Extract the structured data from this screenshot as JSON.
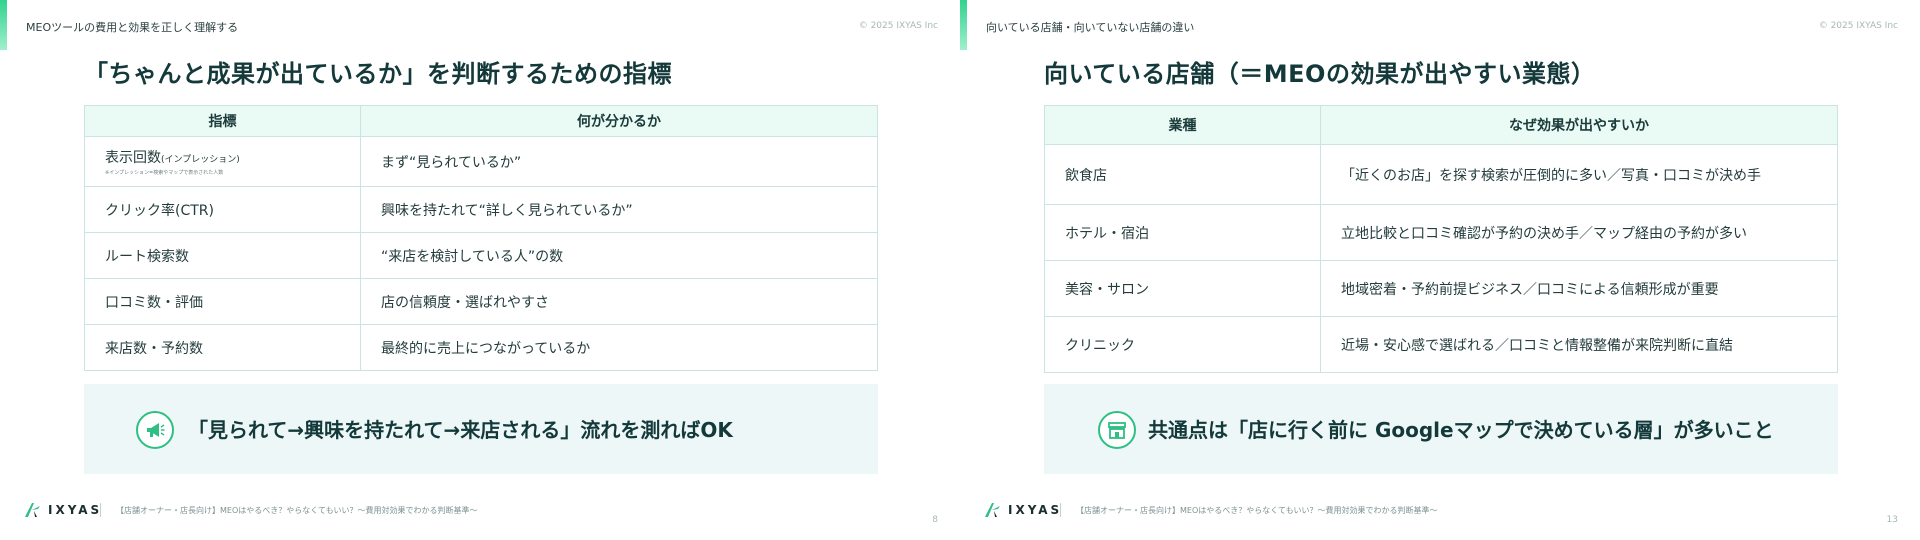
{
  "slides": [
    {
      "section_label": "MEOツールの費用と効果を正しく理解する",
      "copyright": "© 2025 IXYAS Inc",
      "title": "「ちゃんと成果が出ているか」を判断するための指標",
      "table": {
        "headers": [
          "指標",
          "何が分かるか"
        ],
        "rows": [
          {
            "c1": "表示回数",
            "c1_paren": "(インプレッション)",
            "c1_note": "※インプレッション=検索やマップで表示された人数",
            "c2": "まず“見られているか”"
          },
          {
            "c1": "クリック率(CTR)",
            "c2": "興味を持たれて“詳しく見られているか”"
          },
          {
            "c1": "ルート検索数",
            "c2": "“来店を検討している人”の数"
          },
          {
            "c1": "口コミ数・評価",
            "c2": "店の信頼度・選ばれやすさ"
          },
          {
            "c1": "来店数・予約数",
            "c2": "最終的に売上につながっているか"
          }
        ]
      },
      "callout": {
        "icon": "megaphone-icon",
        "text": "「見られて→興味を持たれて→来店される」流れを測ればOK"
      },
      "footer": {
        "logo": "IXYAS",
        "text": "【店舗オーナー・店長向け】MEOはやるべき？やらなくてもいい？〜費用対効果でわかる判断基準〜",
        "page": "8"
      }
    },
    {
      "section_label": "向いている店舗・向いていない店舗の違い",
      "copyright": "© 2025 IXYAS Inc",
      "title": "向いている店舗（＝MEOの効果が出やすい業態）",
      "table": {
        "headers": [
          "業種",
          "なぜ効果が出やすいか"
        ],
        "rows": [
          {
            "c1": "飲食店",
            "c2": "「近くのお店」を探す検索が圧倒的に多い／写真・口コミが決め手"
          },
          {
            "c1": "ホテル・宿泊",
            "c2": "立地比較と口コミ確認が予約の決め手／マップ経由の予約が多い"
          },
          {
            "c1": "美容・サロン",
            "c2": "地域密着・予約前提ビジネス／口コミによる信頼形成が重要"
          },
          {
            "c1": "クリニック",
            "c2": "近場・安心感で選ばれる／口コミと情報整備が来院判断に直結"
          }
        ]
      },
      "callout": {
        "icon": "store-icon",
        "text": "共通点は「店に行く前に Googleマップで決めている層」が多いこと"
      },
      "footer": {
        "logo": "IXYAS",
        "text": "【店舗オーナー・店長向け】MEOはやるべき？やらなくてもいい？〜費用対効果でわかる判断基準〜",
        "page": "13"
      }
    }
  ],
  "colors": {
    "accent": "#31d28f",
    "title": "#14393a",
    "table_header_bg": "#e9fbf4",
    "callout_bg": "#edf7f7"
  }
}
